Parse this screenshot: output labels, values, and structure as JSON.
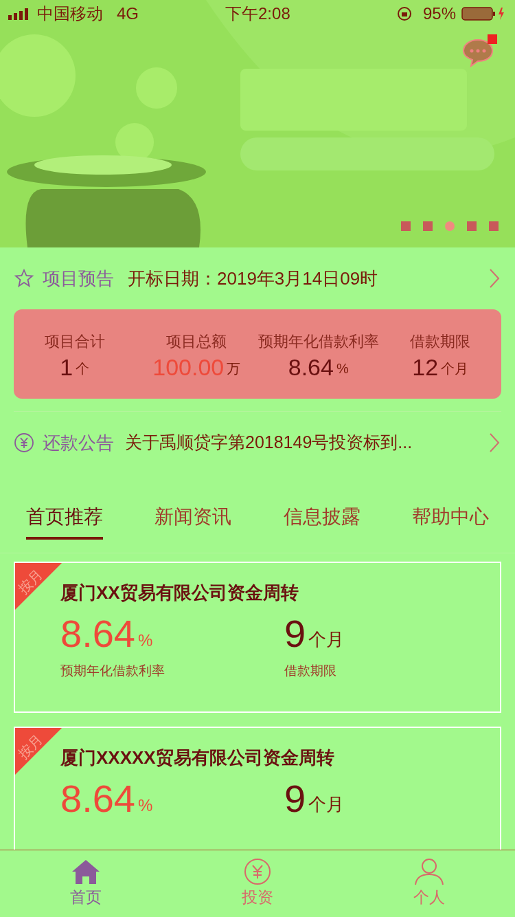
{
  "status_bar": {
    "carrier": "中国移动",
    "network": "4G",
    "time": "下午2:08",
    "battery": "95%"
  },
  "banner": {
    "kind": "picture",
    "has_unread": true,
    "dots": [
      {
        "selected": false
      },
      {
        "selected": false
      },
      {
        "selected": true
      },
      {
        "selected": false
      },
      {
        "selected": false
      }
    ]
  },
  "preview": {
    "title": "项目预告",
    "text": "开标日期：2019年3月14日09时"
  },
  "stats": [
    {
      "label": "项目合计",
      "value": "1",
      "unit": "个",
      "accent": false
    },
    {
      "label": "项目总额",
      "value": "100.00",
      "unit": "万",
      "accent": true
    },
    {
      "label": "预期年化借款利率",
      "value": "8.64",
      "unit": "%",
      "accent": false
    },
    {
      "label": "借款期限",
      "value": "12",
      "unit": "个月",
      "accent": false
    }
  ],
  "notice": {
    "title": "还款公告",
    "text": "关于禹顺贷字第2018149号投资标到..."
  },
  "tabs": [
    {
      "label": "首页推荐",
      "selected": true
    },
    {
      "label": "新闻资讯",
      "selected": false
    },
    {
      "label": "信息披露",
      "selected": false
    },
    {
      "label": "帮助中心",
      "selected": false
    }
  ],
  "projects": [
    {
      "tag": "按月",
      "title": "厦门XX贸易有限公司资金周转",
      "rate": "8.64",
      "rate_unit": "%",
      "rate_label": "预期年化借款利率",
      "term": "9",
      "term_unit": "个月",
      "term_label": "借款期限"
    },
    {
      "tag": "按月",
      "title": "厦门XXXXX贸易有限公司资金周转",
      "rate": "8.64",
      "rate_unit": "%",
      "term": "9",
      "term_unit": "个月"
    }
  ],
  "nav": [
    {
      "kind": "home",
      "label": "首页",
      "selected": true
    },
    {
      "kind": "invest",
      "label": "投资",
      "selected": false
    },
    {
      "kind": "person",
      "label": "个人",
      "selected": false
    }
  ]
}
